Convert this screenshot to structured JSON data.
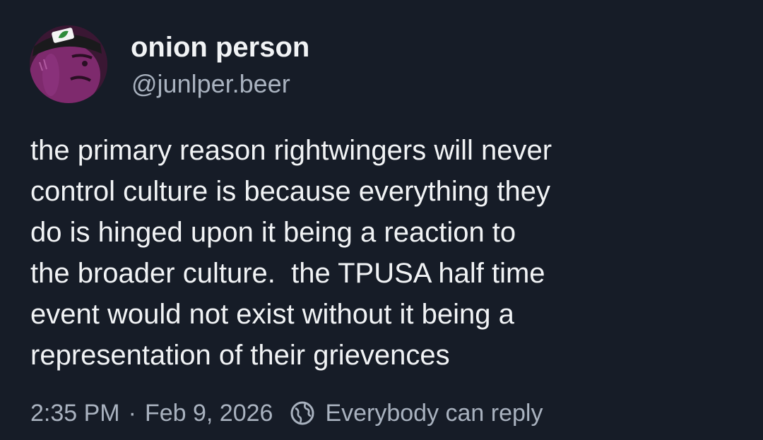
{
  "author": {
    "display_name": "onion person",
    "handle": "@junlper.beer",
    "avatar_icon": "purple-onion-with-headband-avatar"
  },
  "post": {
    "lines": [
      "the primary reason rightwingers will never",
      "control culture is because everything they",
      "do is hinged upon it being a reaction to",
      "the broader culture.  the TPUSA half time",
      "event would not exist without it being a",
      "representation of their grievences"
    ]
  },
  "meta": {
    "time": "2:35 PM",
    "separator": "·",
    "date": "Feb 9, 2026",
    "reply_setting": "Everybody can reply",
    "reply_icon": "globe-icon"
  },
  "colors": {
    "background": "#161c27",
    "primary_text": "#f1f3f5",
    "secondary_text": "#a9b2bf",
    "avatar_purple": "#7e2a6d"
  }
}
